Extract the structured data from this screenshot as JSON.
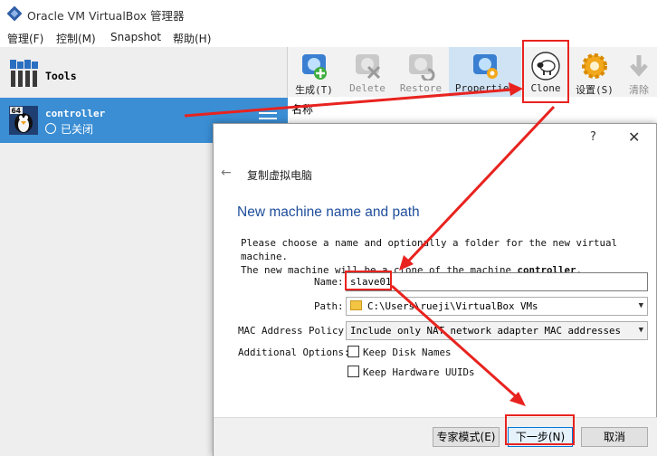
{
  "window": {
    "title": "Oracle VM VirtualBox 管理器"
  },
  "menubar": [
    "管理(F)",
    "控制(M)",
    "Snapshot",
    "帮助(H)"
  ],
  "sidebar": {
    "tools_label": "Tools",
    "vm": {
      "name": "controller",
      "state": "已关闭",
      "os_badge": "64"
    }
  },
  "toolbar": {
    "buttons": [
      {
        "label": "生成(T)",
        "icon": "new-vm-icon",
        "enabled": true
      },
      {
        "label": "Delete",
        "icon": "delete-icon",
        "enabled": false
      },
      {
        "label": "Restore",
        "icon": "restore-icon",
        "enabled": false
      },
      {
        "label": "Properties",
        "icon": "properties-icon",
        "enabled": true,
        "active": true
      },
      {
        "label": "Clone",
        "icon": "sheep-icon",
        "enabled": true
      },
      {
        "label": "设置(S)",
        "icon": "gear-icon",
        "enabled": true
      },
      {
        "label": "清除",
        "icon": "discard-icon",
        "enabled": false
      }
    ]
  },
  "details_peek": "名称",
  "dialog": {
    "help": "?",
    "close": "✕",
    "wizard_title": "复制虚拟电脑",
    "page_title": "New machine name and path",
    "description_line1": "Please choose a name and optionally a folder for the new virtual machine.",
    "description_line2_prefix": "The new machine will be a clone of the machine ",
    "description_machine": "controller",
    "description_suffix": ".",
    "name_label": "Name:",
    "name_value": "slave01",
    "path_label": "Path:",
    "path_value": "C:\\Users\\rueji\\VirtualBox VMs",
    "mac_label": "MAC Address Policy:",
    "mac_value": "Include only NAT network adapter MAC addresses",
    "options_label": "Additional Options:",
    "keep_disk_names": "Keep Disk Names",
    "keep_hw_uuids": "Keep Hardware UUIDs",
    "keep_disk_names_checked": false,
    "keep_hw_uuids_checked": false,
    "expert_button": "专家模式(E)",
    "next_button": "下一步(N)",
    "cancel_button": "取消"
  },
  "colors": {
    "selection": "#3b8ed4",
    "annotation_red": "#e8231f",
    "page_title_blue": "#1f4e9c"
  }
}
